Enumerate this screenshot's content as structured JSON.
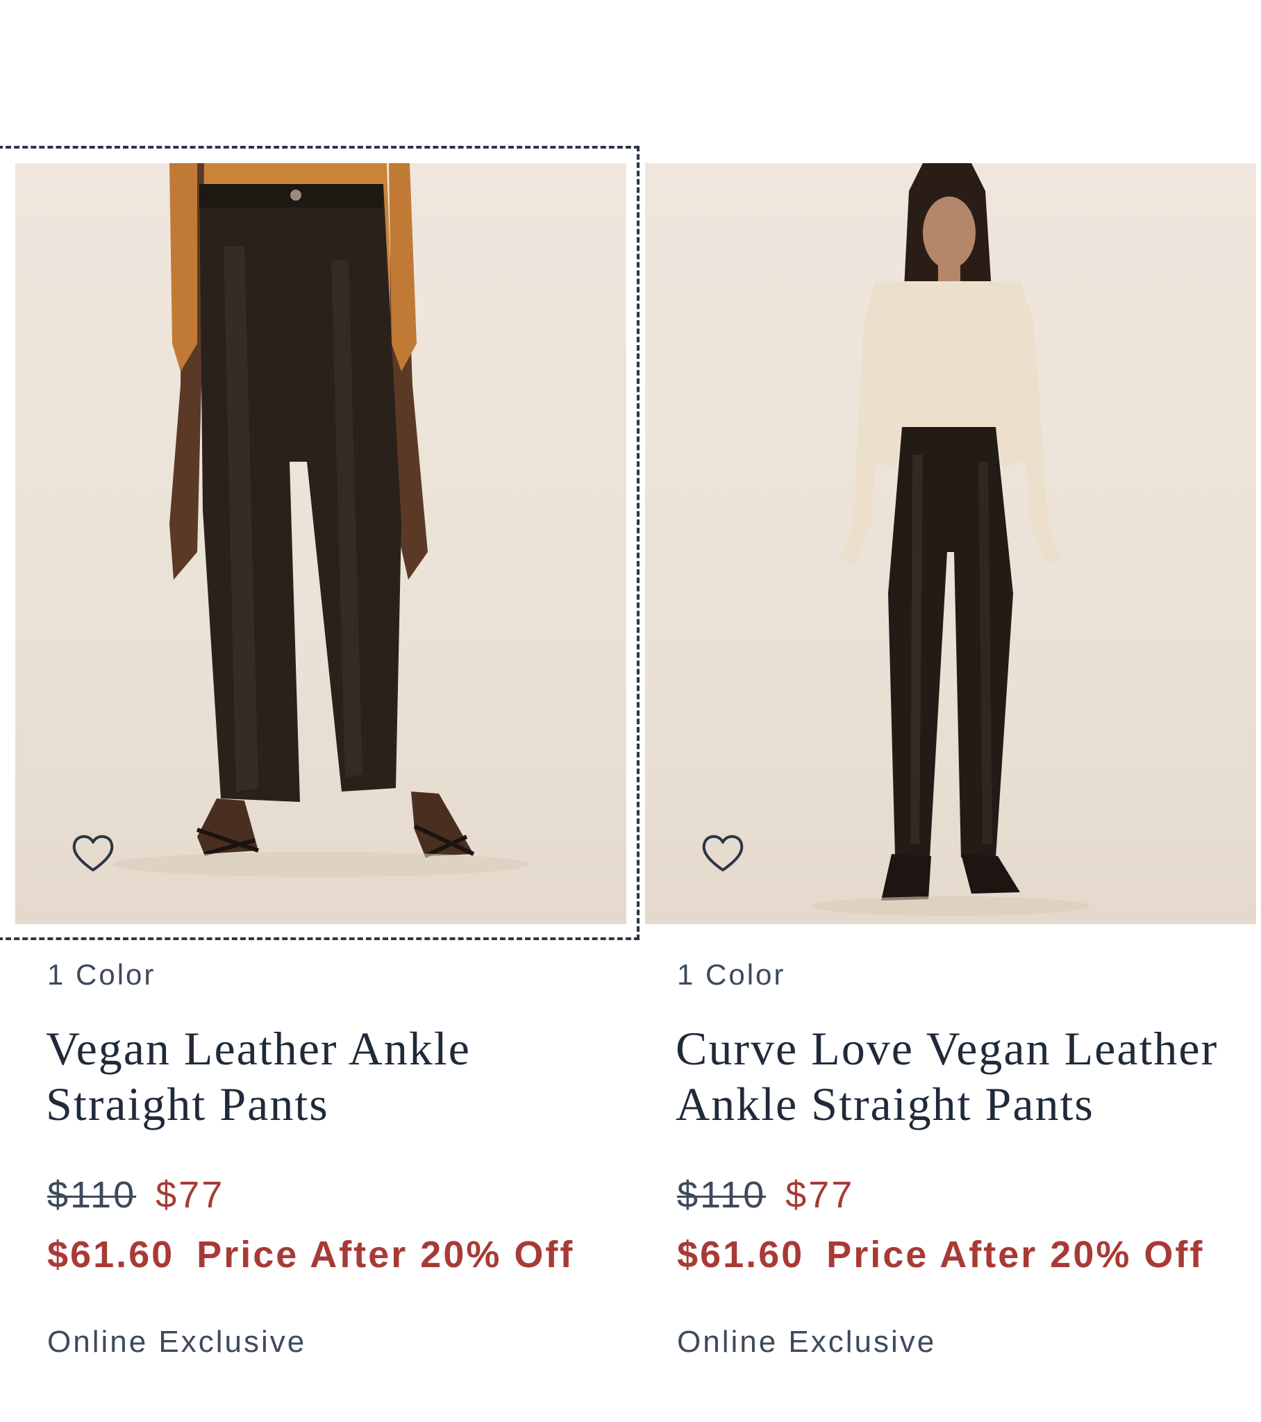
{
  "products": [
    {
      "color_count": "1 Color",
      "title": "Vegan Leather Ankle Straight Pants",
      "original_price": "$110",
      "sale_price": "$77",
      "promo_price": "$61.60",
      "promo_label": "Price After 20% Off",
      "badge": "Online Exclusive",
      "image_alt": "model-lower-body-vegan-leather-pants",
      "favorite_icon": "heart-icon"
    },
    {
      "color_count": "1 Color",
      "title": "Curve Love Vegan Leather Ankle Straight Pants",
      "original_price": "$110",
      "sale_price": "$77",
      "promo_price": "$61.60",
      "promo_label": "Price After 20% Off",
      "badge": "Online Exclusive",
      "image_alt": "model-full-body-vegan-leather-pants",
      "favorite_icon": "heart-icon"
    }
  ],
  "colors": {
    "text_primary": "#1f2a3a",
    "text_secondary": "#3d4a5c",
    "sale_red": "#a83a36",
    "photo_background": "#ebe2d7",
    "focus_outline": "#2b3547"
  }
}
